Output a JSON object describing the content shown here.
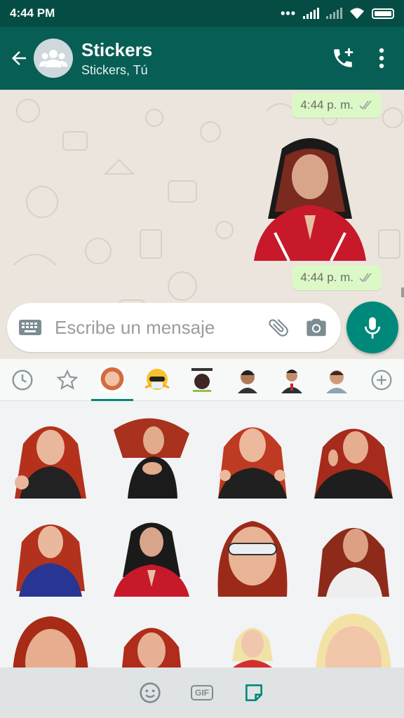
{
  "status_bar": {
    "time": "4:44 PM",
    "dots": "•••"
  },
  "header": {
    "title": "Stickers",
    "subtitle": "Stickers, Tú"
  },
  "messages": [
    {
      "time": "4:44 p. m."
    },
    {
      "type": "sticker",
      "description": "woman in red tracksuit and black headscarf praying"
    },
    {
      "time": "4:44 p. m."
    }
  ],
  "input": {
    "placeholder": "Escribe un mensaje"
  },
  "sticker_picker": {
    "tabs": [
      {
        "name": "recent",
        "icon": "clock-icon"
      },
      {
        "name": "favorites",
        "icon": "star-icon"
      },
      {
        "name": "pack-1",
        "active": true
      },
      {
        "name": "pack-2"
      },
      {
        "name": "pack-3"
      },
      {
        "name": "pack-4"
      },
      {
        "name": "pack-5"
      },
      {
        "name": "pack-6"
      },
      {
        "name": "add",
        "icon": "plus-circle-icon"
      }
    ],
    "sticker_count": 12
  },
  "bottom_bar": {
    "gif_label": "GIF"
  },
  "colors": {
    "header": "#075e54",
    "status": "#054d44",
    "bubble": "#dcf8c6",
    "accent": "#00897b"
  }
}
